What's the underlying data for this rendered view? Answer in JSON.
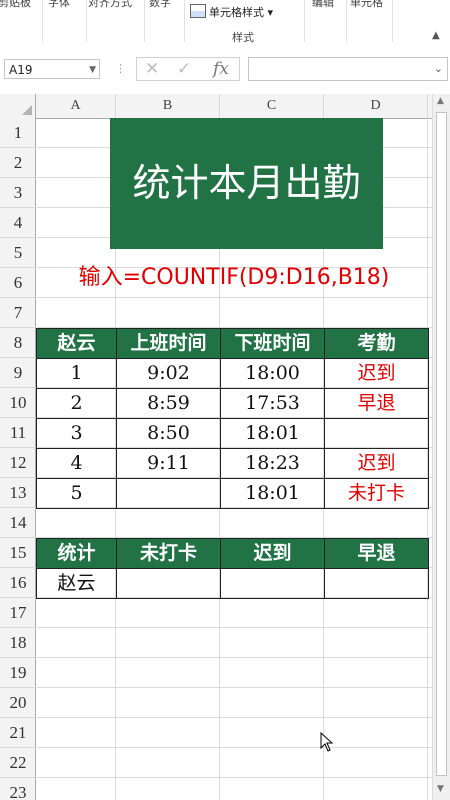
{
  "ribbon": {
    "group_labels": [
      "剪贴板",
      "字体",
      "对齐方式",
      "数字",
      "编辑",
      "单元格"
    ],
    "cell_styles_label": "单元格样式",
    "styles_group_name": "样式"
  },
  "formula_bar": {
    "name_box": "A19",
    "cancel_icon": "x-icon",
    "confirm_icon": "check-icon",
    "fx_label": "fx",
    "formula": ""
  },
  "grid": {
    "columns": [
      "A",
      "B",
      "C",
      "D"
    ],
    "rows": [
      "1",
      "2",
      "3",
      "4",
      "5",
      "6",
      "7",
      "8",
      "9",
      "10",
      "11",
      "12",
      "13",
      "14",
      "15",
      "16",
      "17",
      "18",
      "19",
      "20",
      "21",
      "22",
      "23"
    ]
  },
  "sheet": {
    "title": "统计本月出勤",
    "hint": "输入=COUNTIF(D9:D16,B18)",
    "attendance": {
      "headers": [
        "赵云",
        "上班时间",
        "下班时间",
        "考勤"
      ],
      "rows": [
        [
          "1",
          "9:02",
          "18:00",
          "迟到"
        ],
        [
          "2",
          "8:59",
          "17:53",
          "早退"
        ],
        [
          "3",
          "8:50",
          "18:01",
          ""
        ],
        [
          "4",
          "9:11",
          "18:23",
          "迟到"
        ],
        [
          "5",
          "",
          "18:01",
          "未打卡"
        ]
      ]
    },
    "summary": {
      "headers": [
        "统计",
        "未打卡",
        "迟到",
        "早退"
      ],
      "rows": [
        [
          "赵云",
          "",
          "",
          ""
        ]
      ]
    }
  },
  "colors": {
    "accent": "#217346",
    "alert": "#e00000"
  }
}
